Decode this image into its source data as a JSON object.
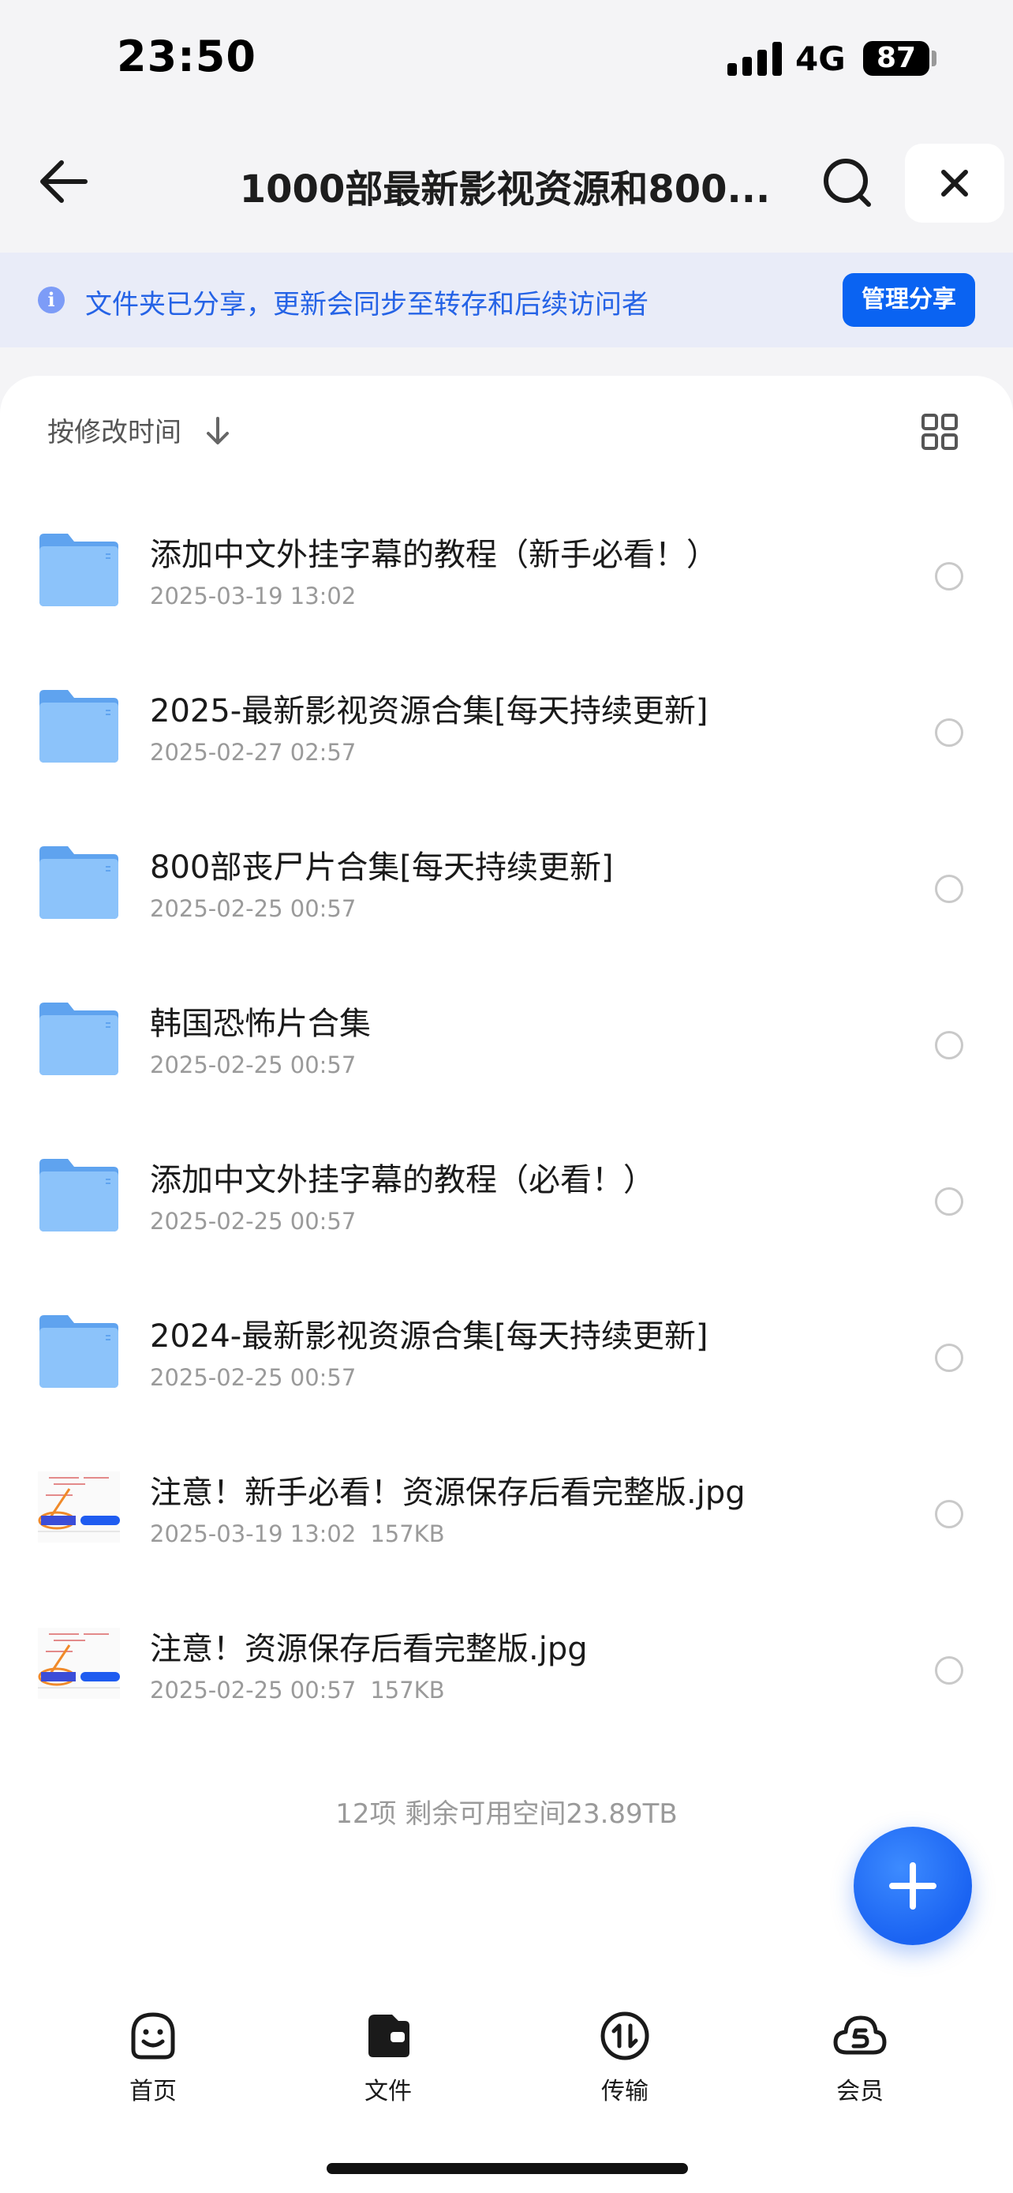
{
  "status_bar": {
    "time": "23:50",
    "network": "4G",
    "battery": "87"
  },
  "nav": {
    "title": "1000部最新影视资源和800..."
  },
  "banner": {
    "text": "文件夹已分享，更新会同步至转存和后续访问者",
    "button": "管理分享"
  },
  "sort": {
    "label": "按修改时间"
  },
  "files": [
    {
      "type": "folder",
      "name": "添加中文外挂字幕的教程（新手必看！）",
      "date": "2025-03-19 13:02",
      "size": ""
    },
    {
      "type": "folder",
      "name": "2025-最新影视资源合集[每天持续更新]",
      "date": "2025-02-27 02:57",
      "size": ""
    },
    {
      "type": "folder",
      "name": "800部丧尸片合集[每天持续更新]",
      "date": "2025-02-25 00:57",
      "size": ""
    },
    {
      "type": "folder",
      "name": "韩国恐怖片合集",
      "date": "2025-02-25 00:57",
      "size": ""
    },
    {
      "type": "folder",
      "name": "添加中文外挂字幕的教程（必看！）",
      "date": "2025-02-25 00:57",
      "size": ""
    },
    {
      "type": "folder",
      "name": "2024-最新影视资源合集[每天持续更新]",
      "date": "2025-02-25 00:57",
      "size": ""
    },
    {
      "type": "image",
      "name": "注意！新手必看！资源保存后看完整版.jpg",
      "date": "2025-03-19 13:02",
      "size": "157KB"
    },
    {
      "type": "image",
      "name": "注意！资源保存后看完整版.jpg",
      "date": "2025-02-25 00:57",
      "size": "157KB"
    }
  ],
  "summary": "12项 剩余可用空间23.89TB",
  "tabs": [
    {
      "label": "首页",
      "icon": "smiley-icon"
    },
    {
      "label": "文件",
      "icon": "wallet-icon"
    },
    {
      "label": "传输",
      "icon": "transfer-icon"
    },
    {
      "label": "会员",
      "icon": "cloud-icon"
    }
  ],
  "colors": {
    "accent": "#0a63f2",
    "banner_bg": "#e9ecf8",
    "banner_text": "#2563e6",
    "folder": "#7ab8f5"
  }
}
